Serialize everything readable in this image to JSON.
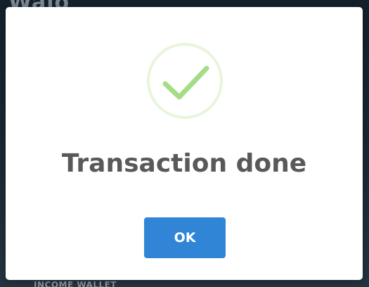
{
  "background": {
    "heading_fragment": "Walo",
    "footer_label": "INCOME WALLET"
  },
  "dialog": {
    "icon": "success-check-icon",
    "title": "Transaction done",
    "confirm_label": "OK"
  },
  "colors": {
    "success": "#a5dc86",
    "success_ring": "#e8f5dd",
    "confirm_button": "#3085d6",
    "title_text": "#595959"
  }
}
